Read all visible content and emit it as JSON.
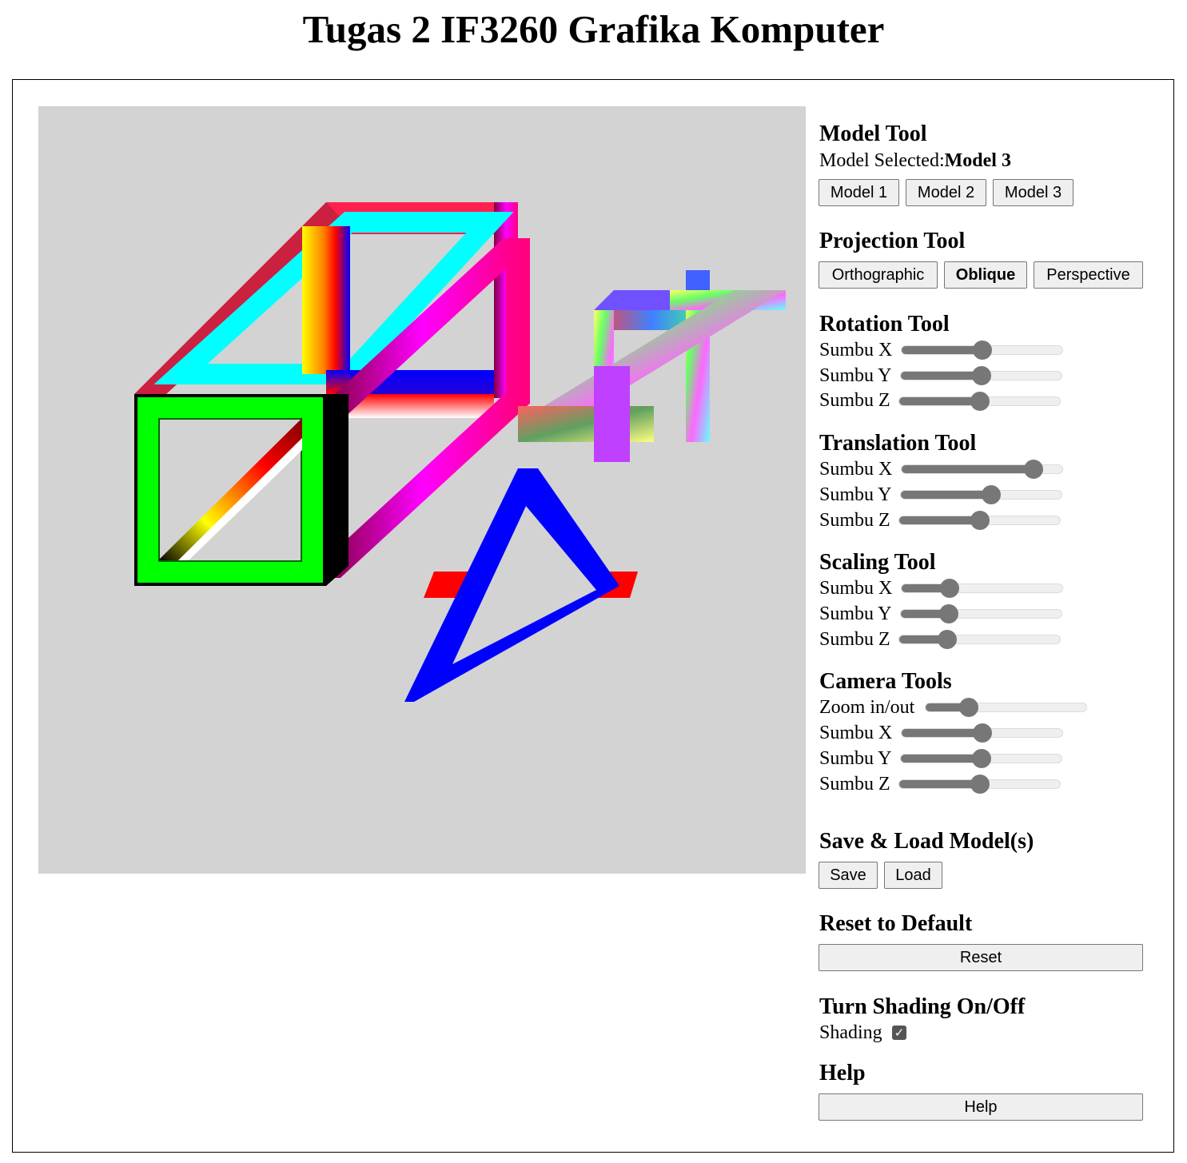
{
  "page": {
    "title": "Tugas 2 IF3260 Grafika Komputer"
  },
  "model_tool": {
    "heading": "Model Tool",
    "selected_label": "Model Selected:",
    "selected_value": "Model 3",
    "buttons": [
      "Model 1",
      "Model 2",
      "Model 3"
    ]
  },
  "projection_tool": {
    "heading": "Projection Tool",
    "buttons": [
      "Orthographic",
      "Oblique",
      "Perspective"
    ],
    "active": "Oblique"
  },
  "rotation_tool": {
    "heading": "Rotation Tool",
    "sliders": [
      {
        "label": "Sumbu X",
        "value": 0.5
      },
      {
        "label": "Sumbu Y",
        "value": 0.5
      },
      {
        "label": "Sumbu Z",
        "value": 0.5
      }
    ]
  },
  "translation_tool": {
    "heading": "Translation Tool",
    "sliders": [
      {
        "label": "Sumbu X",
        "value": 0.82
      },
      {
        "label": "Sumbu Y",
        "value": 0.56
      },
      {
        "label": "Sumbu Z",
        "value": 0.5
      }
    ]
  },
  "scaling_tool": {
    "heading": "Scaling Tool",
    "sliders": [
      {
        "label": "Sumbu X",
        "value": 0.3
      },
      {
        "label": "Sumbu Y",
        "value": 0.3
      },
      {
        "label": "Sumbu Z",
        "value": 0.3
      }
    ]
  },
  "camera_tools": {
    "heading": "Camera Tools",
    "sliders": [
      {
        "label": "Zoom in/out",
        "value": 0.27
      },
      {
        "label": "Sumbu X",
        "value": 0.5
      },
      {
        "label": "Sumbu Y",
        "value": 0.5
      },
      {
        "label": "Sumbu Z",
        "value": 0.5
      }
    ]
  },
  "save_load": {
    "heading": "Save & Load Model(s)",
    "save_label": "Save",
    "load_label": "Load"
  },
  "reset": {
    "heading": "Reset to Default",
    "button_label": "Reset"
  },
  "shading": {
    "heading": "Turn Shading On/Off",
    "label": "Shading",
    "checked": true
  },
  "help": {
    "heading": "Help",
    "button_label": "Help"
  },
  "colors": {
    "canvas_bg": "#d3d3d3",
    "slider_thumb": "#777777"
  }
}
